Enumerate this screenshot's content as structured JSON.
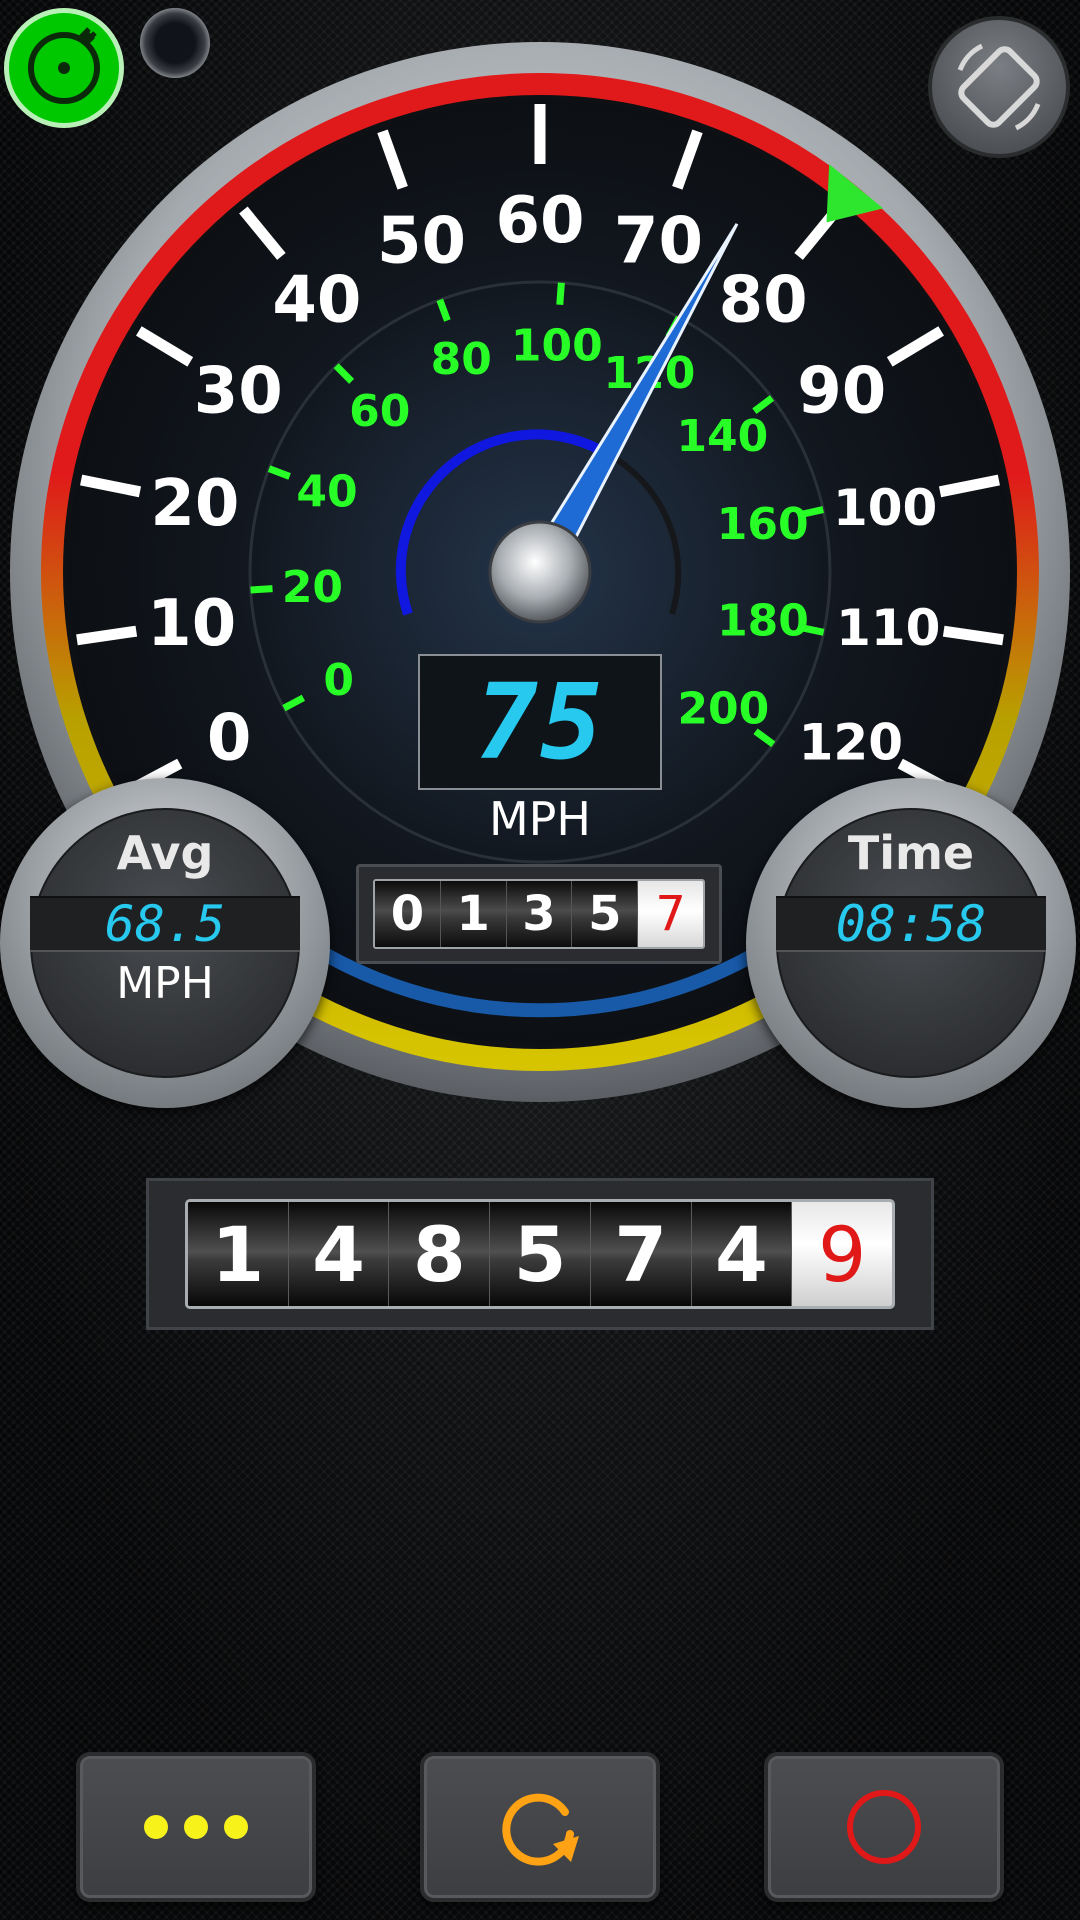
{
  "speedometer": {
    "mph_ticks": [
      "0",
      "10",
      "20",
      "30",
      "40",
      "50",
      "60",
      "70",
      "80",
      "90",
      "100",
      "110",
      "120"
    ],
    "kmh_ticks": [
      "0",
      "20",
      "40",
      "60",
      "80",
      "100",
      "120",
      "140",
      "160",
      "180",
      "200"
    ],
    "current_speed": "75",
    "unit": "MPH",
    "needle_mph": 75,
    "max_marker_mph": 80
  },
  "trip_odometer": {
    "digits": [
      "0",
      "1",
      "3",
      "5",
      "7"
    ]
  },
  "average": {
    "title": "Avg",
    "value": "68.5",
    "unit": "MPH"
  },
  "time": {
    "title": "Time",
    "value": "08:58"
  },
  "odometer": {
    "digits": [
      "1",
      "4",
      "8",
      "5",
      "7",
      "4",
      "9"
    ]
  },
  "top_icons": {
    "gps": "gps-satellite-icon",
    "camera": "camera-lens-icon",
    "rotate": "rotate-screen-icon"
  },
  "buttons": {
    "more": "more-dots-icon",
    "reset": "reset-icon",
    "record": "record-icon"
  },
  "colors": {
    "digital": "#27c9ee",
    "kmh": "#27ff27",
    "needle": "#1f6bd6",
    "red_zone": "#e0141a",
    "gps_green": "#00c800",
    "dots_yellow": "#f7f21a",
    "reset_orange": "#ffa214",
    "record_red": "#e01818"
  }
}
